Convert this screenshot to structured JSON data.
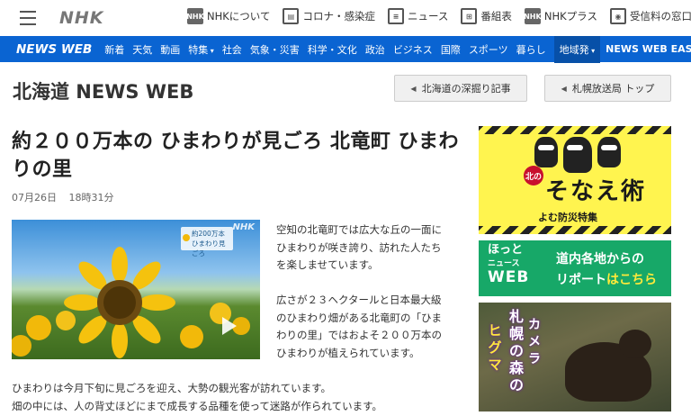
{
  "top_bar": {
    "logo": "NHK",
    "links": [
      {
        "icon": "nhk-badge-icon",
        "badge": "NHK",
        "label": "NHKについて"
      },
      {
        "icon": "bulletin-icon",
        "badge": "",
        "label": "コロナ・感染症"
      },
      {
        "icon": "newspaper-icon",
        "badge": "",
        "label": "ニュース"
      },
      {
        "icon": "grid-icon",
        "badge": "",
        "label": "番組表"
      },
      {
        "icon": "nhk-plus-icon",
        "badge": "NHK",
        "label": "NHKプラス"
      },
      {
        "icon": "camera-icon",
        "badge": "",
        "label": "受信料の窓口"
      }
    ]
  },
  "nav": {
    "brand": "NEWS WEB",
    "items": [
      "新着",
      "天気",
      "動画",
      "特集",
      "社会",
      "気象・災害",
      "科学・文化",
      "政治",
      "ビジネス",
      "国際",
      "スポーツ",
      "暮らし"
    ],
    "region": "地域発",
    "easy": "NEWS WEB EASY",
    "colors": {
      "bar": "#0a64d2",
      "active": "#0750a8"
    }
  },
  "region": {
    "title": "北海道 NEWS WEB",
    "button_deep": "北海道の深掘り記事",
    "button_top": "札幌放送局 トップ"
  },
  "article": {
    "headline": "約２００万本の ひまわりが見ごろ 北竜町 ひまわりの里",
    "date": "07月26日",
    "time": "18時31分",
    "photo_caption_line1": "約200万本",
    "photo_caption_line2": "ひまわり見ごろ",
    "photo_bug": "NHK",
    "para1": "空知の北竜町では広大な丘の一面にひまわりが咲き誇り、訪れた人たちを楽しませています。",
    "para2": "広さが２３ヘクタールと日本最大級のひまわり畑がある北竜町の「ひまわりの里」ではおよそ２００万本のひまわりが植えられています。",
    "para3": "ひまわりは今月下旬に見ごろを迎え、大勢の観光客が訪れています。",
    "para4": "畑の中には、人の背丈ほどにまで成長する品種を使って迷路が作られています。"
  },
  "sidebar": {
    "banner1": {
      "badge": "北の",
      "title": "そなえ術",
      "subtitle": "よむ防災特集",
      "color": "#fff44f"
    },
    "banner2": {
      "left1": "ほっと",
      "left2": "ニュース",
      "left3": "WEB",
      "right1": "道内各地からの",
      "right2a": "リポート",
      "right2b": "はこちら",
      "color": "#17a868"
    },
    "banner3": {
      "col1": "札幌の森の",
      "col2": "ヒグマ",
      "col3": "カメラ"
    }
  }
}
